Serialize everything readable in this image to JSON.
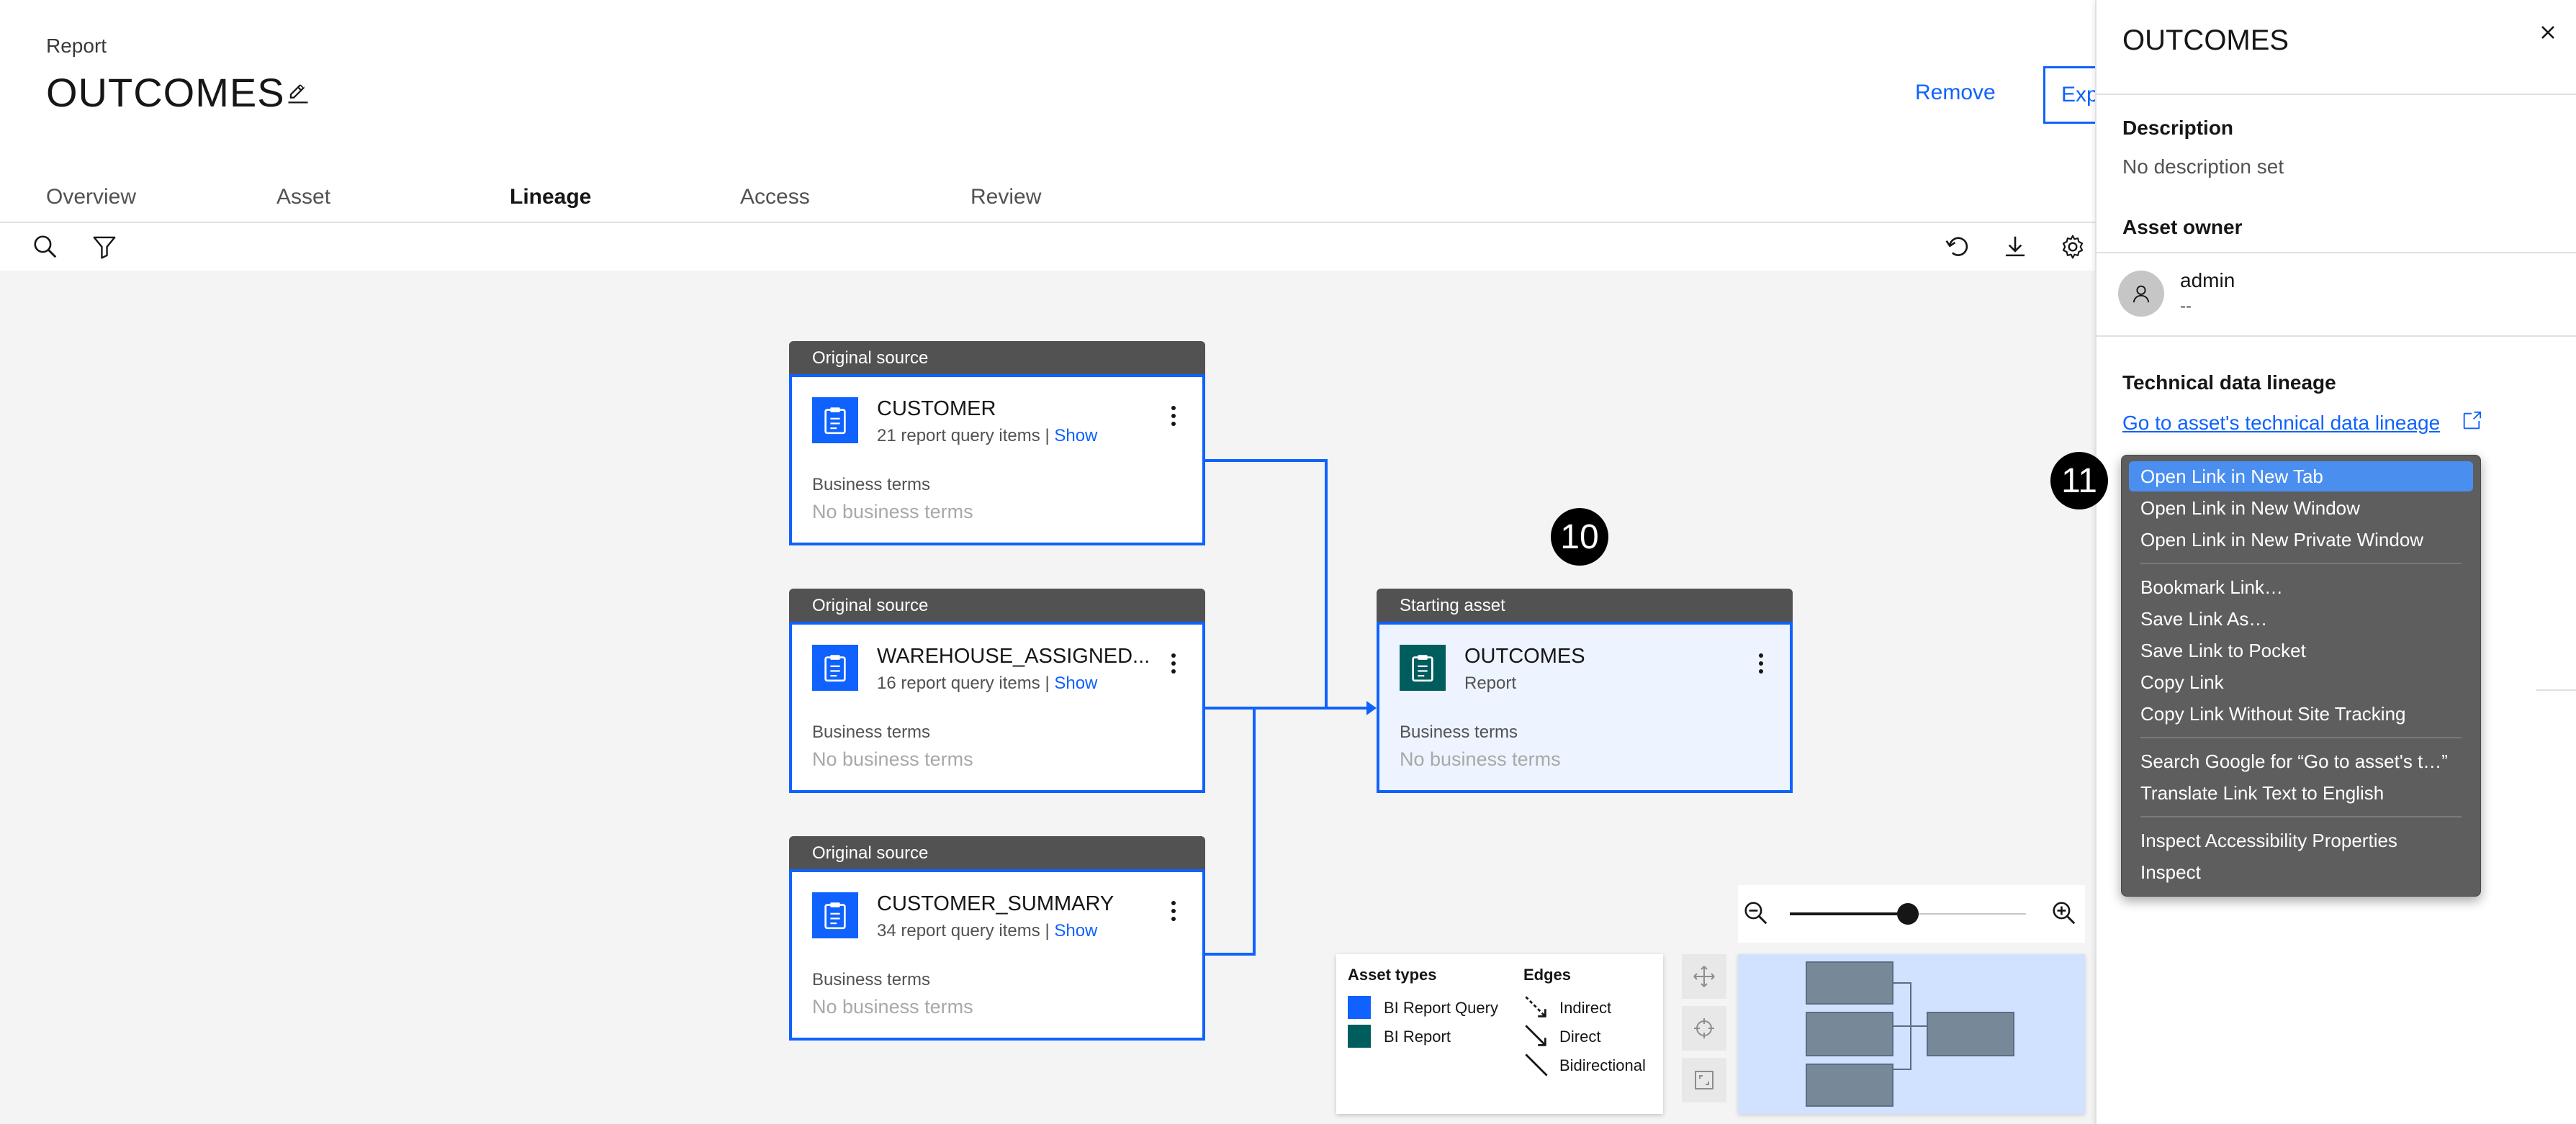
{
  "header": {
    "breadcrumb": "Report",
    "title": "OUTCOMES",
    "remove_label": "Remove",
    "export_label": "Exp"
  },
  "tabs": [
    {
      "label": "Overview",
      "active": false
    },
    {
      "label": "Asset",
      "active": false
    },
    {
      "label": "Lineage",
      "active": true
    },
    {
      "label": "Access",
      "active": false
    },
    {
      "label": "Review",
      "active": false
    }
  ],
  "nodes": [
    {
      "header": "Original source",
      "title": "CUSTOMER",
      "sub": "21 report query items | ",
      "show": "Show",
      "bt_label": "Business terms",
      "bt_value": "No business terms"
    },
    {
      "header": "Original source",
      "title": "WAREHOUSE_ASSIGNED...",
      "sub": "16 report query items | ",
      "show": "Show",
      "bt_label": "Business terms",
      "bt_value": "No business terms"
    },
    {
      "header": "Original source",
      "title": "CUSTOMER_SUMMARY",
      "sub": "34 report query items | ",
      "show": "Show",
      "bt_label": "Business terms",
      "bt_value": "No business terms"
    },
    {
      "header": "Starting asset",
      "title": "OUTCOMES",
      "sub": "Report",
      "bt_label": "Business terms",
      "bt_value": "No business terms"
    }
  ],
  "badges": {
    "ten": "10",
    "eleven": "11"
  },
  "legend": {
    "asset_types_title": "Asset types",
    "edges_title": "Edges",
    "asset_types": [
      "BI Report Query",
      "BI Report"
    ],
    "edges": [
      "Indirect",
      "Direct",
      "Bidirectional"
    ],
    "colors": {
      "bi_report_query": "#0f62fe",
      "bi_report": "#005d5d"
    }
  },
  "zoom": {
    "level": 0.5
  },
  "panel": {
    "title": "OUTCOMES",
    "description_label": "Description",
    "description_value": "No description set",
    "owner_label": "Asset owner",
    "owner_name": "admin",
    "owner_sub": "--",
    "lineage_label": "Technical data lineage",
    "lineage_link": "Go to asset's technical data lineage"
  },
  "context_menu": {
    "items": [
      "Open Link in New Tab",
      "Open Link in New Window",
      "Open Link in New Private Window",
      "Bookmark Link…",
      "Save Link As…",
      "Save Link to Pocket",
      "Copy Link",
      "Copy Link Without Site Tracking",
      "Search Google for “Go to asset's t…”",
      "Translate Link Text to English",
      "Inspect Accessibility Properties",
      "Inspect"
    ],
    "highlighted": "Open Link in New Tab"
  },
  "colors": {
    "accent": "#0f62fe",
    "node_header": "#525252",
    "canvas": "#f4f4f4"
  }
}
